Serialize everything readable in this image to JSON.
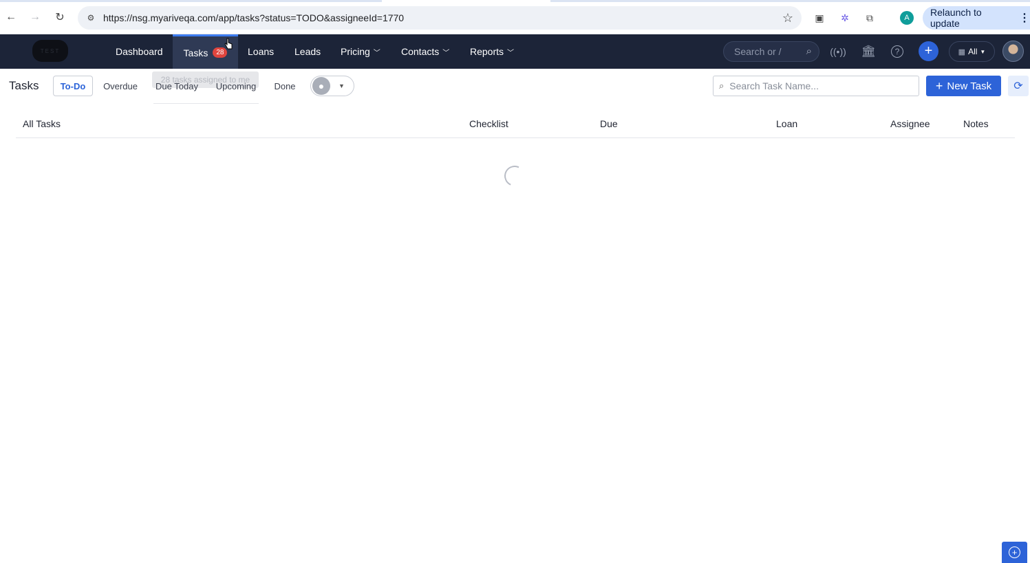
{
  "browser": {
    "url": "https://nsg.myariveqa.com/app/tasks?status=TODO&assigneeId=1770",
    "profile_initial": "A",
    "relaunch_label": "Relaunch to update"
  },
  "navbar": {
    "logo_text": "TEST",
    "items": [
      {
        "label": "Dashboard"
      },
      {
        "label": "Tasks",
        "badge": "28"
      },
      {
        "label": "Loans"
      },
      {
        "label": "Leads"
      },
      {
        "label": "Pricing"
      },
      {
        "label": "Contacts"
      },
      {
        "label": "Reports"
      }
    ],
    "search_placeholder": "Search or /",
    "org_select": "All"
  },
  "tooltip": "28 tasks assigned to me",
  "page": {
    "title": "Tasks",
    "filters": [
      "To-Do",
      "Overdue",
      "Due Today",
      "Upcoming",
      "Done"
    ],
    "active_filter": "To-Do",
    "search_placeholder": "Search Task Name...",
    "new_task_label": "New Task"
  },
  "table": {
    "columns": [
      "All Tasks",
      "Checklist",
      "Due",
      "Loan",
      "Assignee",
      "Notes"
    ]
  },
  "colors": {
    "navbar_bg": "#1c2438",
    "accent": "#2d63d8",
    "badge": "#e0453e"
  }
}
